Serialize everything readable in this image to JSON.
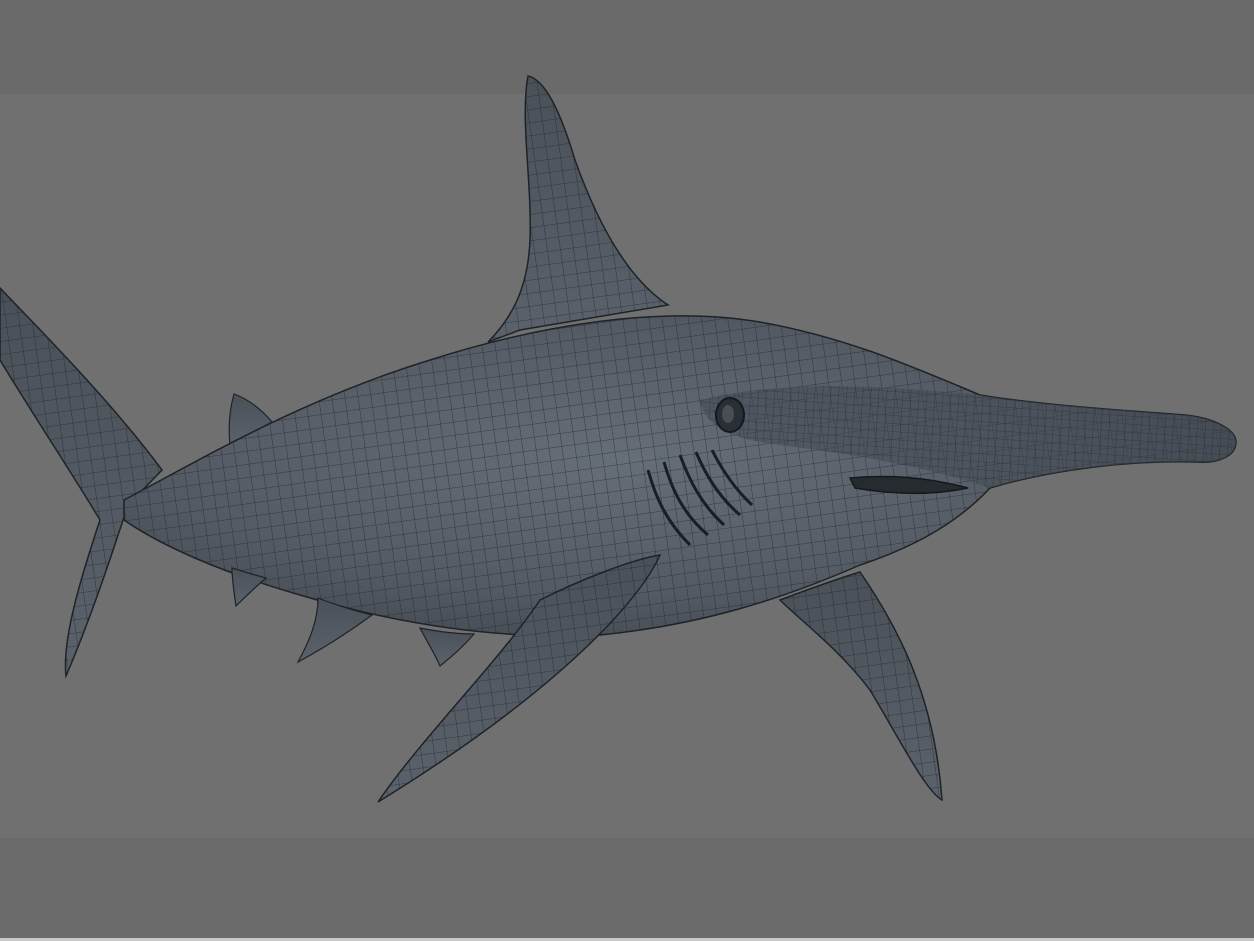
{
  "viewport": {
    "background_color": "#6b6b6b",
    "backdrop_color": "#707070",
    "bottom_edge_color": "#c9c9c9"
  },
  "model": {
    "subject": "hammerhead-shark",
    "display_mode": "wireframe-on-shaded",
    "body_color": "#4f565f",
    "body_highlight_color": "#666e78",
    "wire_color": "#1e2328"
  }
}
